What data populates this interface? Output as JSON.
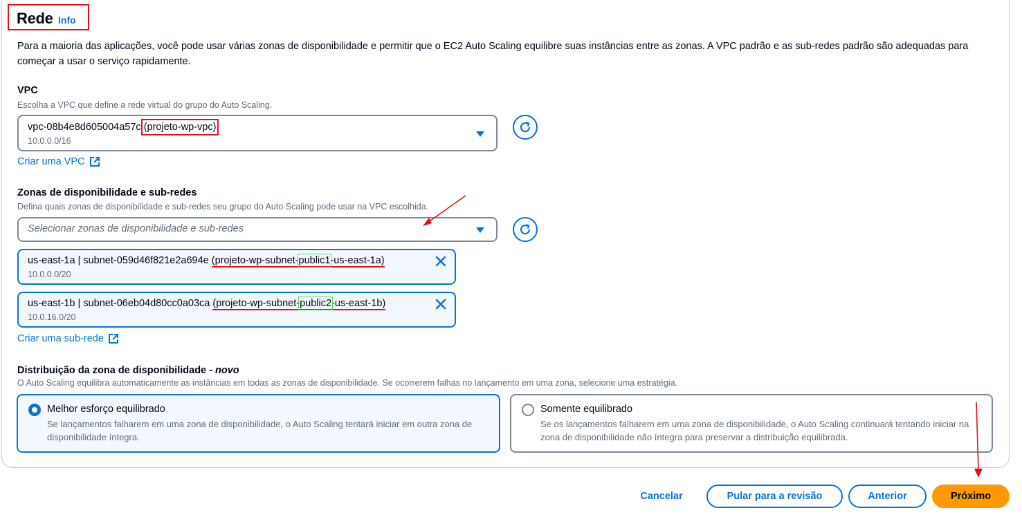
{
  "section": {
    "title": "Rede",
    "info": "Info",
    "description": "Para a maioria das aplicações, você pode usar várias zonas de disponibilidade e permitir que o EC2 Auto Scaling equilibre suas instâncias entre as zonas. A VPC padrão e as sub-redes padrão são adequadas para começar a usar o serviço rapidamente."
  },
  "vpc": {
    "label": "VPC",
    "hint": "Escolha a VPC que define a rede virtual do grupo do Auto Scaling.",
    "selected_id": "vpc-08b4e8d605004a57c",
    "selected_name": "(projeto-wp-vpc)",
    "cidr": "10.0.0.0/16",
    "create_link": "Criar uma VPC"
  },
  "subnets": {
    "label": "Zonas de disponibilidade e sub-redes",
    "hint": "Defina quais zonas de disponibilidade e sub-redes seu grupo do Auto Scaling pode usar na VPC escolhida.",
    "placeholder": "Selecionar zonas de disponibilidade e sub-redes",
    "tokens": [
      {
        "prefix": "us-east-1a | subnet-059d46f821e2a694e ",
        "name_a": "(projeto-wp-subnet-",
        "name_b": "public1",
        "name_c": "-us-east-1a)",
        "cidr": "10.0.0.0/20"
      },
      {
        "prefix": "us-east-1b | subnet-06eb04d80cc0a03ca ",
        "name_a": "(projeto-wp-subnet-",
        "name_b": "public2",
        "name_c": "-us-east-1b)",
        "cidr": "10.0.16.0/20"
      }
    ],
    "create_link": "Criar uma sub-rede"
  },
  "distribution": {
    "label": "Distribuição da zona de disponibilidade - ",
    "label_new": "novo",
    "hint": "O Auto Scaling equilibra automaticamente as instâncias em todas as zonas de disponibilidade. Se ocorrerem falhas no lançamento em uma zona, selecione uma estratégia.",
    "options": [
      {
        "title": "Melhor esforço equilibrado",
        "description": "Se lançamentos falharem em uma zona de disponibilidade, o Auto Scaling tentará iniciar em outra zona de disponibilidade íntegra.",
        "selected": true
      },
      {
        "title": "Somente equilibrado",
        "description": "Se os lançamentos falharem em uma zona de disponibilidade, o Auto Scaling continuará tentando iniciar na zona de disponibilidade não íntegra para preservar a distribuição equilibrada.",
        "selected": false
      }
    ]
  },
  "footer": {
    "cancel": "Cancelar",
    "skip": "Pular para a revisão",
    "previous": "Anterior",
    "next": "Próximo"
  },
  "colors": {
    "accent": "#0972d3",
    "primary_button": "#ff9900",
    "annotation_red": "#e0131a",
    "annotation_green": "#5cd65c"
  }
}
